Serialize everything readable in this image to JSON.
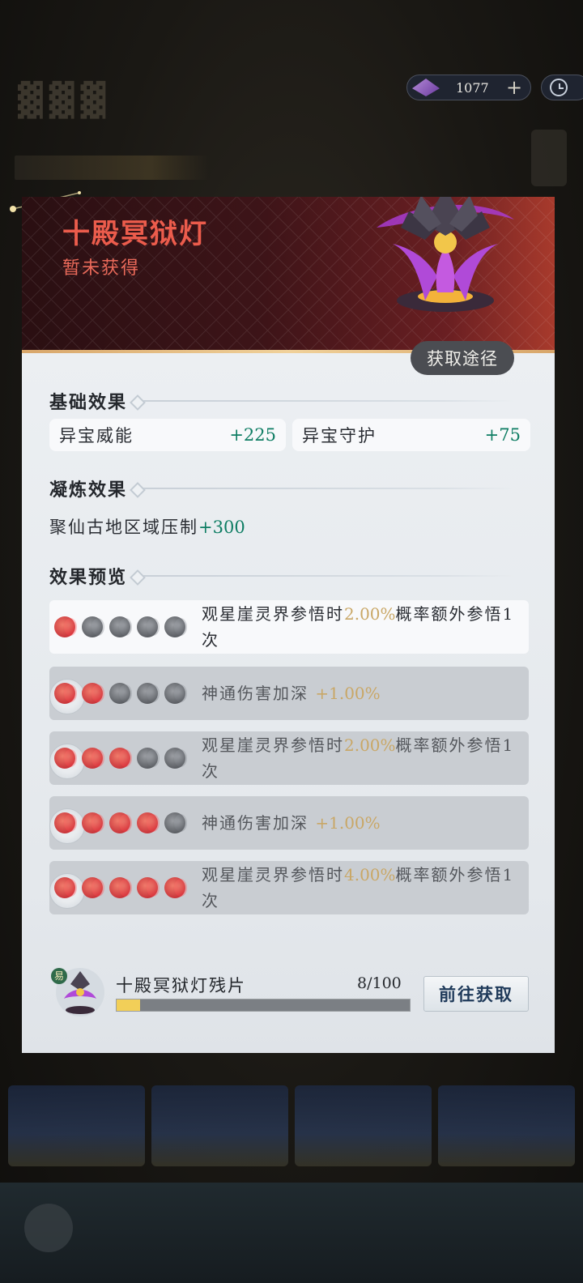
{
  "currency": {
    "icon": "spirit-crystal-icon",
    "amount": "1077",
    "add_label": "+"
  },
  "item": {
    "name": "十殿冥狱灯",
    "status": "暂未获得",
    "acquire_label": "获取途径"
  },
  "base_effect": {
    "title": "基础效果",
    "stats": [
      {
        "label": "异宝威能",
        "value": "+225"
      },
      {
        "label": "异宝守护",
        "value": "+75"
      }
    ]
  },
  "refine_effect": {
    "title": "凝炼效果",
    "label": "聚仙古地区域压制",
    "value": "+300"
  },
  "preview": {
    "title": "效果预览",
    "rows": [
      {
        "level": 1,
        "text_before": "观星崖灵界参悟时",
        "pct": "2.00%",
        "text_after": "概率额外参悟1次"
      },
      {
        "level": 2,
        "text_before": "神通伤害加深 ",
        "pct": "+1.00%",
        "text_after": ""
      },
      {
        "level": 3,
        "text_before": "观星崖灵界参悟时",
        "pct": "2.00%",
        "text_after": "概率额外参悟1次"
      },
      {
        "level": 4,
        "text_before": "神通伤害加深 ",
        "pct": "+1.00%",
        "text_after": ""
      },
      {
        "level": 5,
        "text_before": "观星崖灵界参悟时",
        "pct": "4.00%",
        "text_after": "概率额外参悟1次"
      }
    ]
  },
  "fragment": {
    "badge": "易",
    "name": "十殿冥狱灯残片",
    "count": "8/100",
    "progress": 0.08,
    "go_label": "前往获取"
  },
  "colors": {
    "accent_red": "#ec5c4c",
    "stat_green": "#0e7d63",
    "pct_gold": "#c9a766",
    "progress_yellow": "#f2cf58"
  }
}
